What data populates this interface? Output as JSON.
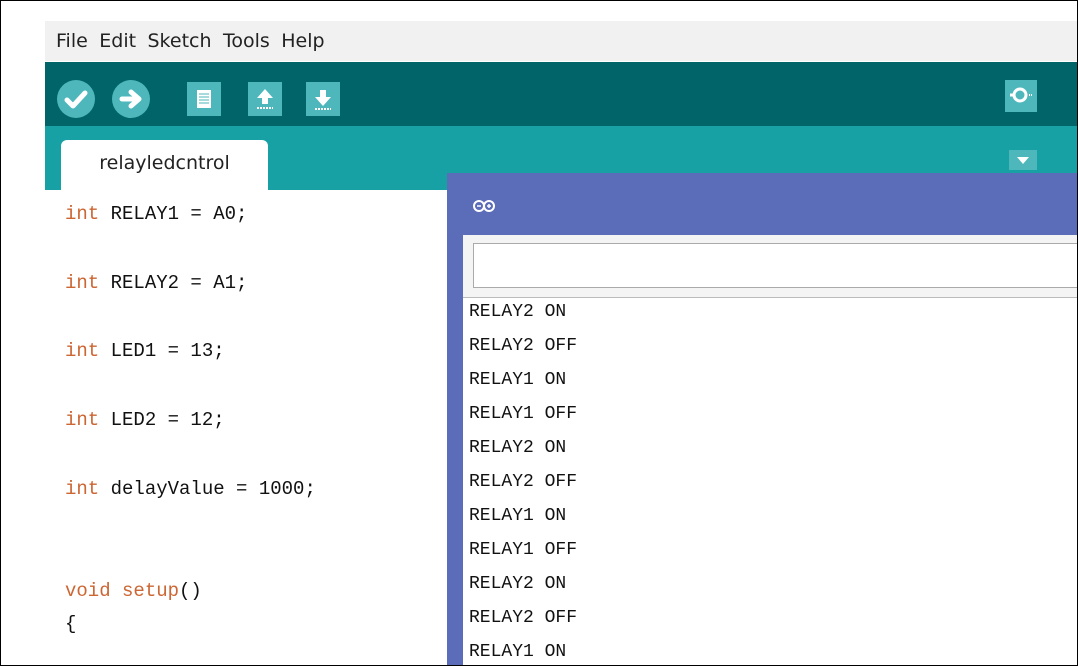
{
  "menu": [
    "File",
    "Edit",
    "Sketch",
    "Tools",
    "Help"
  ],
  "toolbar": {
    "buttons": [
      "verify-icon",
      "upload-icon",
      "new-icon",
      "open-icon",
      "save-icon",
      "serial-monitor-icon"
    ]
  },
  "tab": {
    "label": "relayledcntrol"
  },
  "editor": {
    "lines": [
      {
        "kw": "int",
        "rest": " RELAY1 = A0;"
      },
      {
        "kw": "int",
        "rest": " RELAY2 = A1;"
      },
      {
        "kw": "int",
        "rest": " LED1 = 13;"
      },
      {
        "kw": "int",
        "rest": " LED2 = 12;"
      },
      {
        "kw": "int",
        "rest": " delayValue = 1000;"
      },
      {
        "kw": "void",
        "fn": "setup",
        "rest": "()"
      },
      {
        "kw": "",
        "rest": "{"
      }
    ]
  },
  "serial": {
    "input_value": "",
    "output": [
      "RELAY2 ON",
      "RELAY2 OFF",
      "RELAY1 ON",
      "RELAY1 OFF",
      "RELAY2 ON",
      "RELAY2 OFF",
      "RELAY1 ON",
      "RELAY1 OFF",
      "RELAY2 ON",
      "RELAY2 OFF",
      "RELAY1 ON"
    ]
  },
  "colors": {
    "toolbar": "#006468",
    "tabstrip": "#17a1a5",
    "button": "#4db7bb",
    "serial_frame": "#5b6cb8",
    "keyword": "#cc6633"
  }
}
